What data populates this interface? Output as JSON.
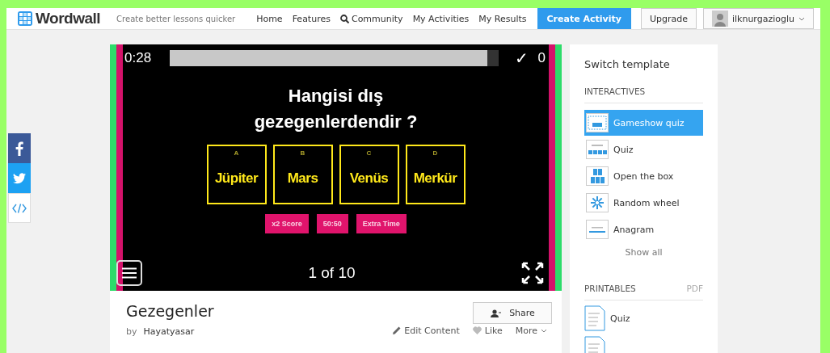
{
  "header": {
    "logo": "Wordwall",
    "tagline": "Create better lessons quicker",
    "nav": [
      {
        "label": "Home",
        "kind": "plain"
      },
      {
        "label": "Features",
        "kind": "plain"
      },
      {
        "label": "Community",
        "kind": "search"
      },
      {
        "label": "My Activities",
        "kind": "plain"
      },
      {
        "label": "My Results",
        "kind": "plain"
      }
    ],
    "create": "Create Activity",
    "upgrade": "Upgrade",
    "user": "ilknurgazioglu"
  },
  "social": [
    {
      "kind": "facebook"
    },
    {
      "kind": "twitter"
    },
    {
      "kind": "embed"
    }
  ],
  "game": {
    "timer": "0:28",
    "progress": {
      "level": 0.965
    },
    "check": "✓",
    "score": "0",
    "question": "Hangisi dış gezegenlerdendir ?",
    "answers": [
      {
        "letter": "A",
        "text": "Jüpiter"
      },
      {
        "letter": "B",
        "text": "Mars"
      },
      {
        "letter": "C",
        "text": "Venüs"
      },
      {
        "letter": "D",
        "text": "Merkür"
      }
    ],
    "powerups": [
      "x2 Score",
      "50:50",
      "Extra Time"
    ],
    "counter": "1 of 10"
  },
  "activity": {
    "title": "Gezegenler",
    "by": "by",
    "author": "Hayatyasar",
    "share": "Share",
    "actions": [
      {
        "kind": "edit",
        "label": "Edit Content"
      },
      {
        "kind": "like",
        "label": "Like"
      },
      {
        "kind": "more",
        "label": "More"
      }
    ]
  },
  "sidebar": {
    "title": "Switch template",
    "interactives": "INTERACTIVES",
    "templates": [
      {
        "kind": "gameshow",
        "label": "Gameshow quiz",
        "selected": true
      },
      {
        "kind": "quiz",
        "label": "Quiz",
        "selected": false
      },
      {
        "kind": "box",
        "label": "Open the box",
        "selected": false
      },
      {
        "kind": "wheel",
        "label": "Random wheel",
        "selected": false
      },
      {
        "kind": "anagram",
        "label": "Anagram",
        "selected": false
      }
    ],
    "show_all": "Show all",
    "printables": "PRINTABLES",
    "pdf": "PDF",
    "printable_items": [
      {
        "kind": "labelled",
        "label": "Quiz"
      },
      {
        "kind": "cut"
      }
    ]
  }
}
